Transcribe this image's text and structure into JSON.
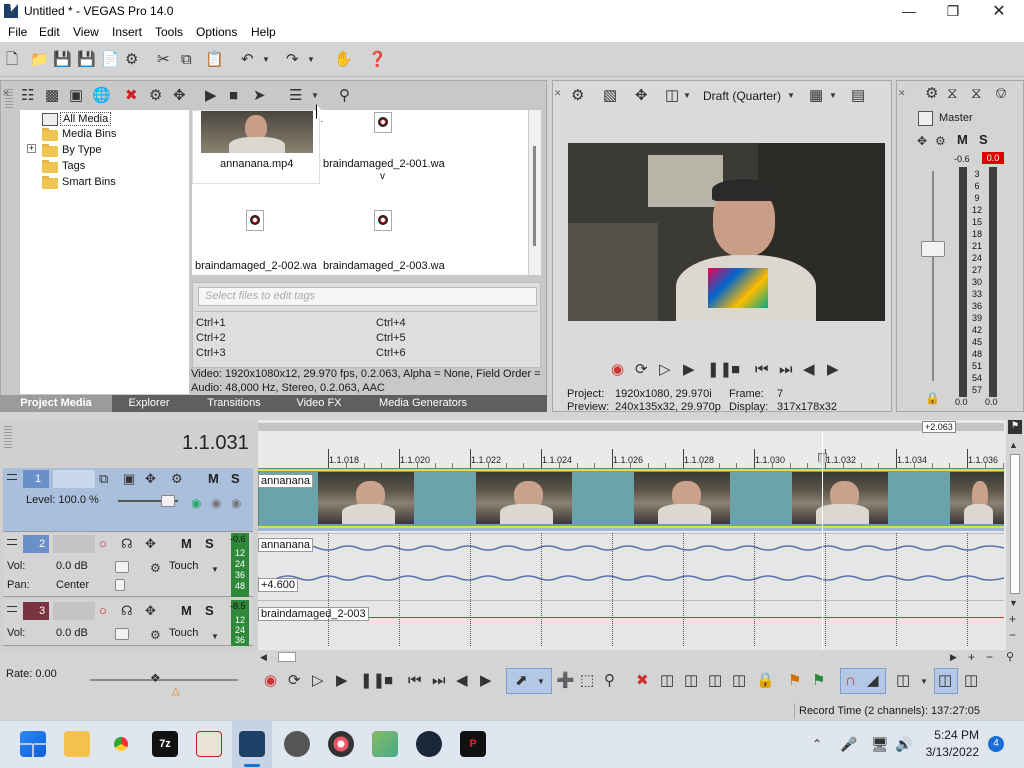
{
  "window": {
    "title": "Untitled * - VEGAS Pro 14.0"
  },
  "menu": [
    "File",
    "Edit",
    "View",
    "Insert",
    "Tools",
    "Options",
    "Help"
  ],
  "project_media": {
    "tree": [
      {
        "label": "All Media",
        "expander": ""
      },
      {
        "label": "Media Bins",
        "expander": ""
      },
      {
        "label": "By Type",
        "expander": "+"
      },
      {
        "label": "Tags",
        "expander": ""
      },
      {
        "label": "Smart Bins",
        "expander": ""
      }
    ],
    "files": [
      {
        "name": "annanana.mp4",
        "extra": ""
      },
      {
        "name": "braindamaged_2-001.wa",
        "extra": "v"
      },
      {
        "name": "braindamaged_2-002.wa",
        "extra": ""
      },
      {
        "name": "braindamaged_2-003.wa",
        "extra": ""
      }
    ],
    "tag_placeholder": "Select files to edit tags",
    "shortcuts": [
      "Ctrl+1",
      "Ctrl+4",
      "Ctrl+2",
      "Ctrl+5",
      "Ctrl+3",
      "Ctrl+6"
    ],
    "info_video": "Video: 1920x1080x12, 29.970 fps, 0.2.063, Alpha = None, Field Order =",
    "info_audio": "Audio: 48,000 Hz, Stereo, 0.2.063, AAC",
    "tabs": [
      "Project Media",
      "Explorer",
      "Transitions",
      "Video FX",
      "Media Generators"
    ]
  },
  "preview": {
    "quality": "Draft (Quarter)",
    "project_label": "Project:",
    "project_value": "1920x1080, 29.970i",
    "preview_label": "Preview:",
    "preview_value": "240x135x32, 29.970p",
    "frame_label": "Frame:",
    "frame_value": "7",
    "display_label": "Display:",
    "display_value": "317x178x32"
  },
  "mixer": {
    "title": "Master",
    "m": "M",
    "s": "S",
    "db_left": "-0.6",
    "db_right": "0.0",
    "scale": [
      "3",
      "6",
      "9",
      "12",
      "15",
      "18",
      "21",
      "24",
      "27",
      "30",
      "33",
      "36",
      "39",
      "42",
      "45",
      "48",
      "51",
      "54",
      "57"
    ],
    "bottom_left": "0.0",
    "bottom_right": "0.0"
  },
  "timeline": {
    "timecode": "1.1.031",
    "position_badge": "+2.063",
    "ruler": [
      "1.1.018",
      "1.1.020",
      "1.1.022",
      "1.1.024",
      "1.1.026",
      "1.1.028",
      "1.1.030",
      "1.1.032",
      "1.1.034",
      "1.1.036"
    ],
    "track1": {
      "num": "1",
      "level": "Level: 100.0 %",
      "m": "M",
      "s": "S"
    },
    "track2": {
      "num": "2",
      "vol_label": "Vol:",
      "vol_value": "0.0 dB",
      "pan_label": "Pan:",
      "pan_value": "Center",
      "mode": "Touch",
      "meter_top": "-0.6",
      "meter": [
        "12",
        "24",
        "36",
        "48"
      ],
      "m": "M",
      "s": "S"
    },
    "track3": {
      "num": "3",
      "vol_label": "Vol:",
      "vol_value": "0.0 dB",
      "mode": "Touch",
      "meter_top": "-8.5",
      "meter": [
        "12",
        "24",
        "36"
      ],
      "m": "M",
      "s": "S"
    },
    "clip_video": "annanana",
    "clip_audio": "annanana",
    "clip_audio_offset": "+4.600",
    "clip_audio2": "braindamaged_2-003",
    "rate": "Rate: 0.00"
  },
  "status": {
    "record_time": "Record Time (2 channels): 137:27:05"
  },
  "taskbar": {
    "time": "5:24 PM",
    "date": "3/13/2022",
    "badge": "4"
  },
  "colors": {
    "track_selected": "#a9bfdc",
    "clip_teal": "#6ba3a8",
    "title_bg": "#ffffff",
    "mute_red": "#e00000"
  }
}
